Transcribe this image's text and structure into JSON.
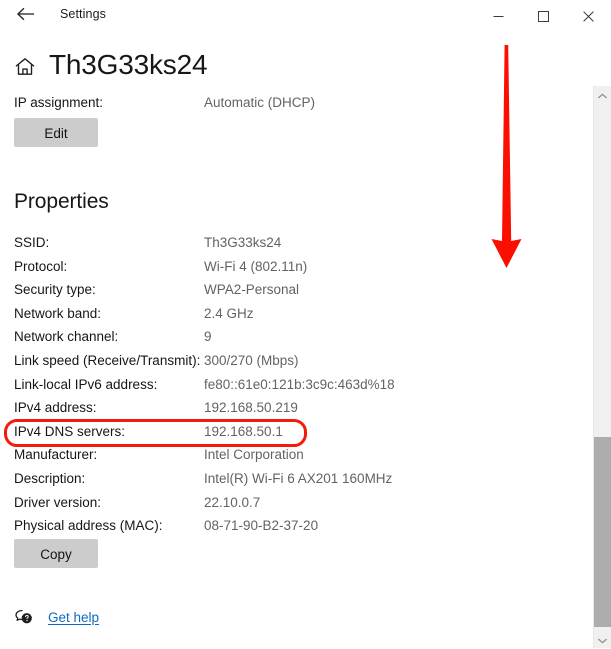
{
  "window": {
    "titlebar": {
      "back_icon": "back-arrow-icon",
      "title": "Settings",
      "minimize_label": "—",
      "maximize_label": "□",
      "close_label": "✕"
    }
  },
  "header": {
    "home_icon": "home-icon",
    "title": "Th3G33ks24"
  },
  "ip_assignment": {
    "label": "IP assignment:",
    "value": "Automatic (DHCP)",
    "edit_button": "Edit"
  },
  "properties": {
    "section_title": "Properties",
    "rows": [
      {
        "label": "SSID:",
        "value": "Th3G33ks24"
      },
      {
        "label": "Protocol:",
        "value": "Wi-Fi 4 (802.11n)"
      },
      {
        "label": "Security type:",
        "value": "WPA2-Personal"
      },
      {
        "label": "Network band:",
        "value": "2.4 GHz"
      },
      {
        "label": "Network channel:",
        "value": "9"
      },
      {
        "label": "Link speed (Receive/Transmit):",
        "value": "300/270 (Mbps)"
      },
      {
        "label": "Link-local IPv6 address:",
        "value": "fe80::61e0:121b:3c9c:463d%18"
      },
      {
        "label": "IPv4 address:",
        "value": "192.168.50.219"
      },
      {
        "label": "IPv4 DNS servers:",
        "value": "192.168.50.1"
      },
      {
        "label": "Manufacturer:",
        "value": "Intel Corporation"
      },
      {
        "label": "Description:",
        "value": "Intel(R) Wi-Fi 6 AX201 160MHz"
      },
      {
        "label": "Driver version:",
        "value": "22.10.0.7"
      },
      {
        "label": "Physical address (MAC):",
        "value": "08-71-90-B2-37-20"
      }
    ],
    "copy_button": "Copy"
  },
  "get_help": {
    "icon": "help-bubble-icon",
    "label": "Get help",
    "link_color": "#0d6ac4"
  },
  "scrollbar": {
    "up_arrow_icon": "chevron-up-icon",
    "down_arrow_icon": "chevron-down-icon"
  },
  "annotations": {
    "highlight_color": "#f31b0c",
    "highlight_target": "IPv4 DNS servers row",
    "arrow_color": "#fa0f00",
    "arrow_direction": "down"
  }
}
